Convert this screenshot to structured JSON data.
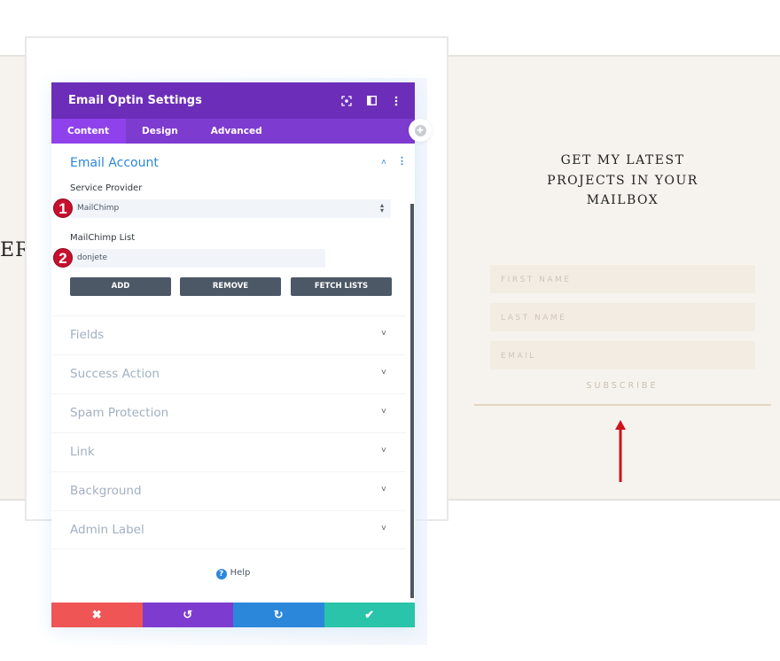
{
  "background_page": {
    "left_partial_heading": "ER",
    "optin": {
      "title": "GET MY LATEST PROJECTS IN YOUR MAILBOX",
      "fields": [
        {
          "placeholder": "FIRST NAME"
        },
        {
          "placeholder": "LAST NAME"
        },
        {
          "placeholder": "EMAIL"
        }
      ],
      "subscribe_label": "SUBSCRIBE"
    },
    "annotation_arrow_color": "#d0121b"
  },
  "panel": {
    "title": "Email Optin Settings",
    "header_icons": [
      "expand-icon",
      "sidebar-layout-icon",
      "more-options-icon"
    ],
    "tabs": [
      {
        "label": "Content",
        "active": true
      },
      {
        "label": "Design",
        "active": false
      },
      {
        "label": "Advanced",
        "active": false
      }
    ],
    "email_account": {
      "heading": "Email Account",
      "service_provider_label": "Service Provider",
      "service_provider_value": "MailChimp",
      "list_label": "MailChimp List",
      "list_value": "donjete",
      "badges": [
        "1",
        "2"
      ],
      "buttons": {
        "add": "ADD",
        "remove": "REMOVE",
        "fetch": "FETCH LISTS"
      }
    },
    "sections": [
      {
        "label": "Fields"
      },
      {
        "label": "Success Action"
      },
      {
        "label": "Spam Protection"
      },
      {
        "label": "Link"
      },
      {
        "label": "Background"
      },
      {
        "label": "Admin Label"
      }
    ],
    "help_label": "Help",
    "footer": {
      "cancel_icon": "✖",
      "undo_icon": "↺",
      "redo_icon": "↻",
      "save_icon": "✔"
    },
    "colors": {
      "header": "#6c2eb9",
      "tabs": "#7e3bd0",
      "active_tab": "#8f42ec",
      "accent_blue": "#2b87da",
      "cancel": "#ef5555",
      "undo": "#7e3bd0",
      "redo": "#2b87da",
      "save": "#29c4a9"
    }
  }
}
